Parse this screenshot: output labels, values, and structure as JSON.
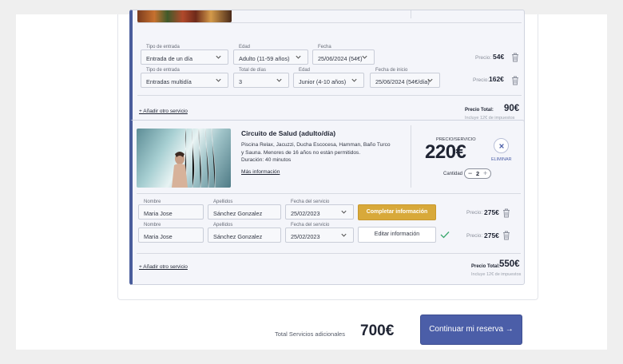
{
  "card1": {
    "rows": [
      {
        "fields": [
          {
            "label": "Tipo de entrada",
            "value": "Entrada de un día"
          },
          {
            "label": "Edad",
            "value": "Adulto (11-59 años)"
          },
          {
            "label": "Fecha",
            "value": "25/06/2024 (54€)"
          }
        ],
        "price_label": "Precio:",
        "price": "54€"
      },
      {
        "fields": [
          {
            "label": "Tipo de entrada",
            "value": "Entradas multidía"
          },
          {
            "label": "Total de días",
            "value": "3"
          },
          {
            "label": "Edad",
            "value": "Junior (4-10 años)"
          },
          {
            "label": "Fecha de inicio",
            "value": "25/06/2024 (54€/día)"
          }
        ],
        "price_label": "Precio:",
        "price": "162€"
      }
    ],
    "add_link": "+ Añadir otro servicio",
    "total_label": "Precio Total:",
    "total_value": "90€",
    "tax_note": "Incluye 12€ de impuestos"
  },
  "card2": {
    "title": "Circuito de Salud (adulto/día)",
    "description": "Piscina Relax, Jacuzzi, Ducha Escocesa, Hamman, Baño Turco y Sauna. Menores de 16 años no están permitidos.",
    "duration": "Duración: 40 minutos",
    "more_info": "Más información",
    "price_header": "PRECIO/SERVICIO",
    "price_big": "220€",
    "remove_label": "ELIMINAR",
    "quantity_label": "Cantidad",
    "quantity": "2",
    "guests": [
      {
        "fields": [
          {
            "label": "Nombre",
            "value": "Maria Jose"
          },
          {
            "label": "Apellidos",
            "value": "Sánchez Gonzalez"
          },
          {
            "label": "Fecha del servicio",
            "value": "25/02/2023"
          }
        ],
        "button": "Completar información",
        "price_label": "Precio:",
        "price": "275€"
      },
      {
        "fields": [
          {
            "label": "Nombre",
            "value": "Maria Jose"
          },
          {
            "label": "Apellidos",
            "value": "Sánchez Gonzalez"
          },
          {
            "label": "Fecha del servicio",
            "value": "25/02/2023"
          }
        ],
        "button": "Editar información",
        "price_label": "Precio:",
        "price": "275€"
      }
    ],
    "add_link": "+ Añadir otro servicio",
    "total_label": "Precio Total:",
    "total_value": "550€",
    "tax_note": "Incluye 12€ de impuestos"
  },
  "footer": {
    "total_label": "Total Servicios adicionales",
    "total_value": "700€",
    "cta": "Continuar mi reserva →"
  },
  "colors": {
    "accent": "#4b5ea8",
    "gold": "#d8a93a",
    "check": "#3aa76d"
  }
}
